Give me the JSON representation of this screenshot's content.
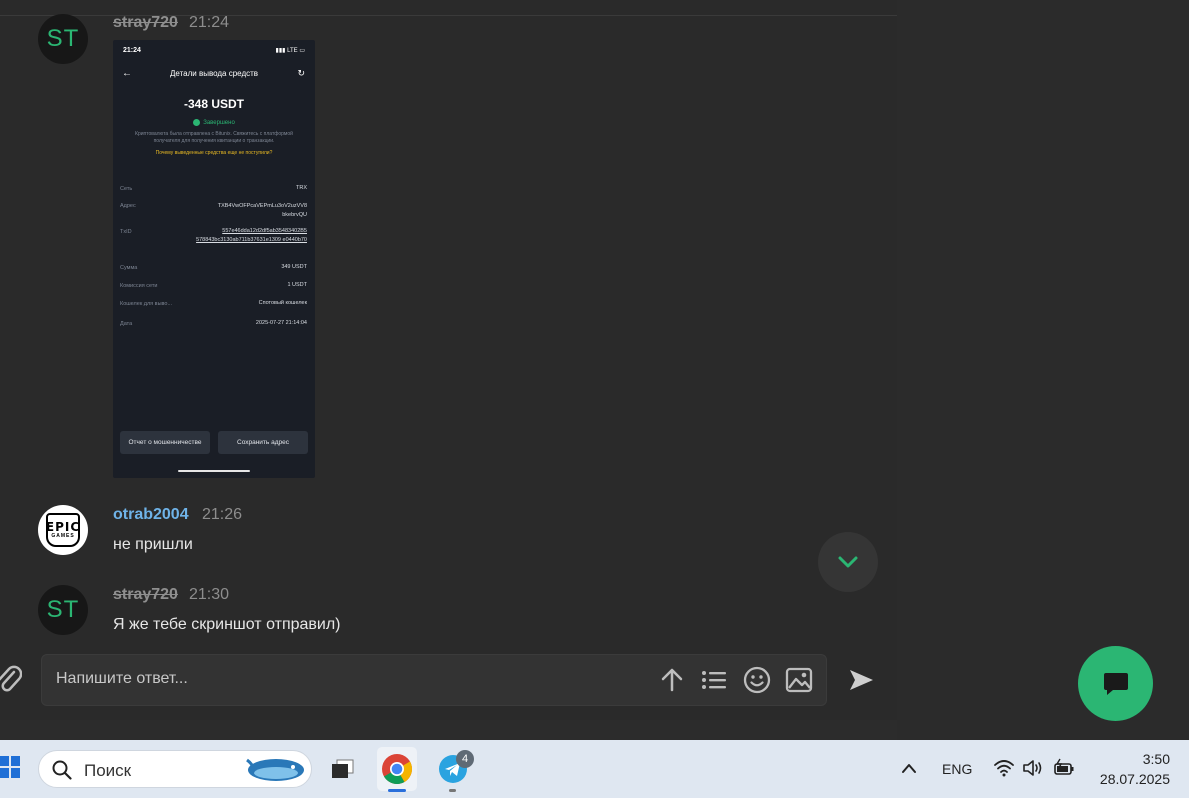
{
  "messages": [
    {
      "username": "stray720",
      "time": "21:24",
      "avatar": "ST"
    },
    {
      "username": "otrab2004",
      "time": "21:26",
      "text": "не пришли",
      "avatar_top": "EPIC",
      "avatar_bottom": "GAMES"
    },
    {
      "username": "stray720",
      "time": "21:30",
      "text": "Я же тебе скриншот отправил)",
      "avatar": "ST"
    }
  ],
  "screenshot": {
    "status_time": "21:24",
    "status_right": "LTE",
    "title": "Детали вывода средств",
    "amount": "-348 USDT",
    "state": "Завершено",
    "description": "Криптовалюта была отправлена с Bitunix. Свяжитесь с платформой получателя для получения квитанции о транзакции.",
    "link": "Почему выведенные средства еще не поступили?",
    "rows": [
      {
        "label": "Сеть",
        "value": "TRX"
      },
      {
        "label": "Адрес",
        "value": "TXB4VwOFPcaVEPmLu3oV2uzVV8 bkebrvQU"
      },
      {
        "label": "TxID",
        "value": "557e46dda12d2df5ab35483402B5 578843bc3130ab711b37631e1309 e0440b70"
      },
      {
        "label": "Сумма",
        "value": "349 USDT"
      },
      {
        "label": "Комиссия сети",
        "value": "1 USDT"
      },
      {
        "label": "Кошелек для выво...",
        "value": "Спотовый кошелек"
      },
      {
        "label": "Дата",
        "value": "2025-07-27 21:14:04"
      }
    ],
    "btn_report": "Отчет о мошенничестве",
    "btn_save": "Сохранить адрес"
  },
  "composer": {
    "placeholder": "Напишите ответ..."
  },
  "taskbar": {
    "search_label": "Поиск",
    "telegram_badge": "4",
    "language": "ENG",
    "time": "3:50",
    "date": "28.07.2025"
  },
  "colors": {
    "accent": "#2bb673",
    "username_blue": "#6fb3e8",
    "background": "#2a2a2a"
  }
}
